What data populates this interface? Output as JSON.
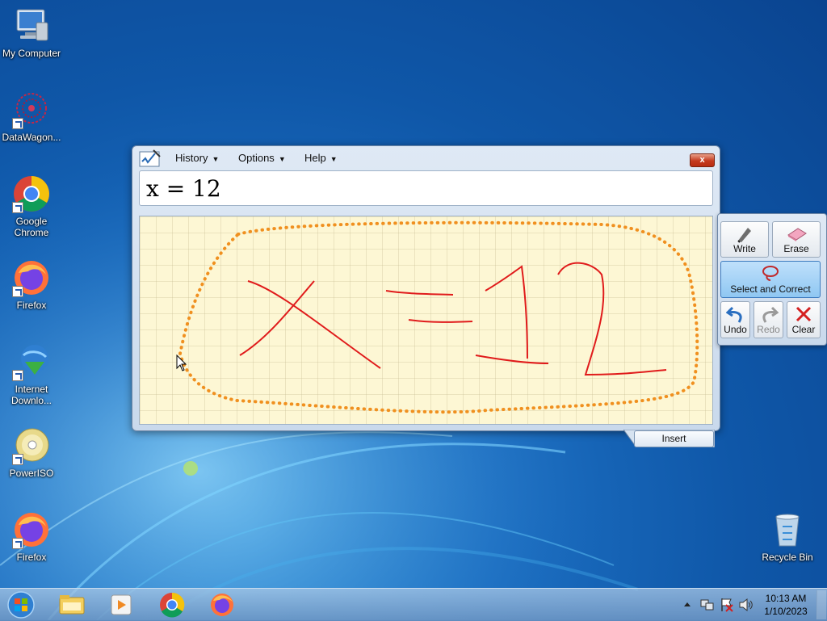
{
  "desktop": {
    "icons": [
      {
        "label": "My Computer",
        "icon": "computer-icon"
      },
      {
        "label": "DataWagon...",
        "icon": "datawagon-icon"
      },
      {
        "label": "Google Chrome",
        "icon": "chrome-icon"
      },
      {
        "label": "Firefox",
        "icon": "firefox-icon"
      },
      {
        "label": "Internet Downlo...",
        "icon": "internet-download-manager-icon"
      },
      {
        "label": "PowerISO",
        "icon": "poweriso-icon"
      },
      {
        "label": "Firefox",
        "icon": "firefox-icon"
      },
      {
        "label": "Recycle Bin",
        "icon": "recycle-bin-icon"
      }
    ]
  },
  "tip": {
    "menus": [
      {
        "label": "History"
      },
      {
        "label": "Options"
      },
      {
        "label": "Help"
      }
    ],
    "close_label": "x",
    "preview": "x = 12",
    "tools": {
      "write": "Write",
      "erase": "Erase",
      "select": "Select and Correct",
      "undo": "Undo",
      "redo": "Redo",
      "clear": "Clear"
    },
    "insert_label": "Insert"
  },
  "taskbar": {
    "time": "10:13 AM",
    "date": "1/10/2023"
  },
  "colors": {
    "ink": "#e01b1b",
    "selection": "#f0901f",
    "pad": "#fdf7d4"
  }
}
